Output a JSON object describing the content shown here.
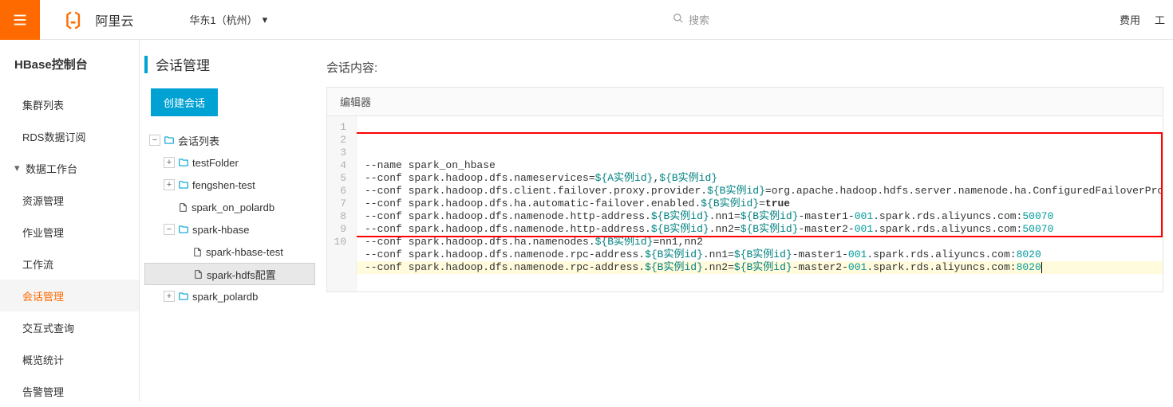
{
  "topbar": {
    "brand": "阿里云",
    "region": "华东1（杭州）",
    "search_placeholder": "搜索",
    "right_links": [
      "费用",
      "工"
    ],
    "icons": {
      "hamburger": "hamburger-icon",
      "search": "search-icon",
      "chevron": "chevron-down-icon"
    }
  },
  "sidebar": {
    "console_title": "HBase控制台",
    "items": [
      {
        "label": "集群列表",
        "type": "item"
      },
      {
        "label": "RDS数据订阅",
        "type": "item"
      },
      {
        "label": "数据工作台",
        "type": "group",
        "expanded": true
      },
      {
        "label": "资源管理",
        "type": "sub"
      },
      {
        "label": "作业管理",
        "type": "sub"
      },
      {
        "label": "工作流",
        "type": "sub"
      },
      {
        "label": "会话管理",
        "type": "sub",
        "active": true
      },
      {
        "label": "交互式查询",
        "type": "sub"
      },
      {
        "label": "概览统计",
        "type": "sub"
      },
      {
        "label": "告警管理",
        "type": "sub"
      }
    ]
  },
  "tree_panel": {
    "page_title": "会话管理",
    "create_button": "创建会话"
  },
  "tree": {
    "root": {
      "label": "会话列表",
      "expanded": true,
      "type": "folder",
      "children": [
        {
          "label": "testFolder",
          "type": "folder",
          "expanded": false
        },
        {
          "label": "fengshen-test",
          "type": "folder",
          "expanded": false
        },
        {
          "label": "spark_on_polardb",
          "type": "file"
        },
        {
          "label": "spark-hbase",
          "type": "folder",
          "expanded": true,
          "children": [
            {
              "label": "spark-hbase-test",
              "type": "file"
            },
            {
              "label": "spark-hdfs配置",
              "type": "file",
              "selected": true
            }
          ]
        },
        {
          "label": "spark_polardb",
          "type": "folder",
          "expanded": false
        }
      ]
    }
  },
  "content": {
    "section_title": "会话内容:",
    "editor_label": "编辑器",
    "highlighted_lines": {
      "start": 2,
      "end": 9
    }
  },
  "code": {
    "lines": [
      "--name spark_on_hbase",
      "--conf spark.hadoop.dfs.nameservices=${A实例id},${B实例id}",
      "--conf spark.hadoop.dfs.client.failover.proxy.provider.${B实例id}=org.apache.hadoop.hdfs.server.namenode.ha.ConfiguredFailoverProxyProvider",
      "--conf spark.hadoop.dfs.ha.automatic-failover.enabled.${B实例id}=true",
      "--conf spark.hadoop.dfs.namenode.http-address.${B实例id}.nn1=${B实例id}-master1-001.spark.rds.aliyuncs.com:50070",
      "--conf spark.hadoop.dfs.namenode.http-address.${B实例id}.nn2=${B实例id}-master2-001.spark.rds.aliyuncs.com:50070",
      "--conf spark.hadoop.dfs.ha.namenodes.${B实例id}=nn1,nn2",
      "--conf spark.hadoop.dfs.namenode.rpc-address.${B实例id}.nn1=${B实例id}-master1-001.spark.rds.aliyuncs.com:8020",
      "--conf spark.hadoop.dfs.namenode.rpc-address.${B实例id}.nn2=${B实例id}-master2-001.spark.rds.aliyuncs.com:8020",
      ""
    ]
  }
}
